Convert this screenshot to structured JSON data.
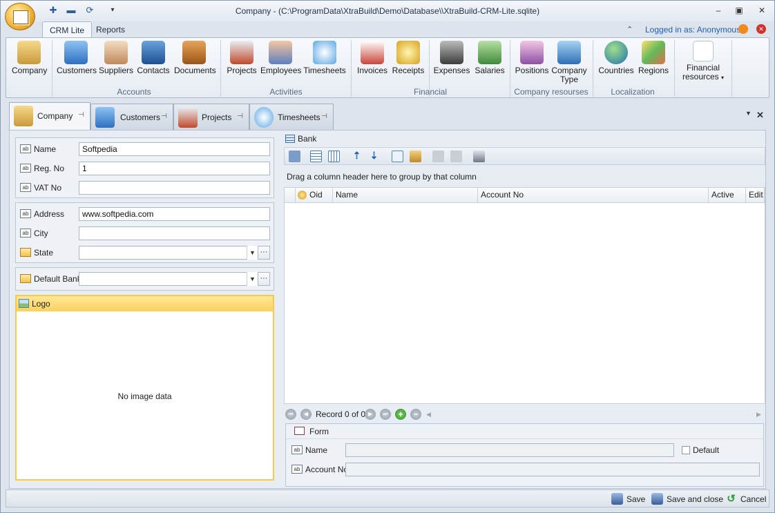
{
  "window": {
    "title": "Company - (C:\\ProgramData\\XtraBuild\\Demo\\Database\\\\XtraBuild-CRM-Lite.sqlite)"
  },
  "ribbon_tabs": [
    {
      "label": "CRM Lite"
    },
    {
      "label": "Reports"
    }
  ],
  "login": {
    "text": "Logged in as: Anonymous"
  },
  "ribbon": {
    "buttons": [
      {
        "label": "Company",
        "icon": "bank-building-icon"
      },
      {
        "label": "Customers",
        "icon": "office-building-icon"
      },
      {
        "label": "Suppliers",
        "icon": "handshake-icon"
      },
      {
        "label": "Contacts",
        "icon": "address-book-icon"
      },
      {
        "label": "Documents",
        "icon": "briefcase-icon"
      },
      {
        "label": "Projects",
        "icon": "tools-icon"
      },
      {
        "label": "Employees",
        "icon": "people-icon"
      },
      {
        "label": "Timesheets",
        "icon": "clock-dollar-icon"
      },
      {
        "label": "Invoices",
        "icon": "invoice-icon"
      },
      {
        "label": "Receipts",
        "icon": "coins-icon"
      },
      {
        "label": "Expenses",
        "icon": "calculator-money-icon"
      },
      {
        "label": "Salaries",
        "icon": "money-bill-icon"
      },
      {
        "label": "Positions",
        "icon": "org-chart-icon"
      },
      {
        "label": "Company",
        "label2": "Type",
        "icon": "buildings-icon"
      },
      {
        "label": "Countries",
        "icon": "globe-icon"
      },
      {
        "label": "Regions",
        "icon": "map-icon"
      },
      {
        "label": "Financial",
        "label2": "resources",
        "icon": "finance-resources-icon"
      }
    ],
    "groups": [
      "Accounts",
      "Activities",
      "Financial",
      "Company resourses",
      "Localization"
    ]
  },
  "doc_tabs": [
    {
      "label": "Company"
    },
    {
      "label": "Customers"
    },
    {
      "label": "Projects"
    },
    {
      "label": "Timesheets"
    }
  ],
  "company_form": {
    "name": {
      "label": "Name",
      "value": "Softpedia"
    },
    "reg_no": {
      "label": "Reg. No",
      "value": "1"
    },
    "vat_no": {
      "label": "VAT No",
      "value": ""
    },
    "address": {
      "label": "Address",
      "value": "www.softpedia.com"
    },
    "city": {
      "label": "City",
      "value": ""
    },
    "state": {
      "label": "State",
      "value": ""
    },
    "default_bank": {
      "label": "Default Bank",
      "value": ""
    },
    "logo": {
      "label": "Logo",
      "empty_text": "No image data"
    }
  },
  "bank": {
    "title": "Bank",
    "group_panel_text": "Drag a column header here to group by that column",
    "columns": [
      "Oid",
      "Name",
      "Account No",
      "Active",
      "Edit"
    ],
    "navigator_text": "Record 0 of 0",
    "form": {
      "title": "Form",
      "name_label": "Name",
      "default_label": "Default",
      "account_label": "Account No"
    }
  },
  "status_bar": {
    "save": "Save",
    "save_close": "Save and close",
    "cancel": "Cancel"
  }
}
